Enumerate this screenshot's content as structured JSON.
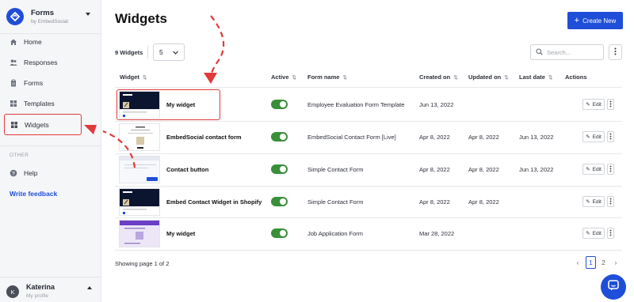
{
  "sidebar": {
    "brand_title": "Forms",
    "brand_sub": "by EmbedSocial",
    "nav": [
      {
        "label": "Home",
        "icon": "home-icon"
      },
      {
        "label": "Responses",
        "icon": "users-icon"
      },
      {
        "label": "Forms",
        "icon": "clipboard-icon"
      },
      {
        "label": "Templates",
        "icon": "grid-icon"
      },
      {
        "label": "Widgets",
        "icon": "grid-icon"
      }
    ],
    "section_other": "OTHER",
    "help": "Help",
    "feedback": "Write feedback",
    "user_name": "Katerina",
    "user_sub": "My profile",
    "user_initial": "K"
  },
  "header": {
    "title": "Widgets",
    "create_label": "Create New"
  },
  "toolbar": {
    "count_label": "9 Widgets",
    "page_size": "5",
    "search_placeholder": "Search..."
  },
  "table": {
    "columns": [
      "Widget",
      "Active",
      "Form name",
      "Created on",
      "Updated on",
      "Last date",
      "Actions"
    ],
    "edit_label": "Edit",
    "rows": [
      {
        "name": "My widget",
        "active": true,
        "form": "Employee Evaluation Form Template",
        "created": "Jun 13, 2022",
        "updated": "",
        "last": ""
      },
      {
        "name": "EmbedSocial contact form",
        "active": true,
        "form": "EmbedSocial Contact Form [Live]",
        "created": "Apr 8, 2022",
        "updated": "Apr 8, 2022",
        "last": "Jun 13, 2022"
      },
      {
        "name": "Contact button",
        "active": true,
        "form": "Simple Contact Form",
        "created": "Apr 8, 2022",
        "updated": "Apr 8, 2022",
        "last": "Jun 13, 2022"
      },
      {
        "name": "Embed Contact Widget in Shopify",
        "active": true,
        "form": "Simple Contact Form",
        "created": "Apr 8, 2022",
        "updated": "Apr 8, 2022",
        "last": ""
      },
      {
        "name": "My widget",
        "active": true,
        "form": "Job Application Form",
        "created": "Mar 28, 2022",
        "updated": "",
        "last": ""
      }
    ]
  },
  "footer": {
    "showing": "Showing page 1 of 2",
    "pages": [
      "1",
      "2"
    ],
    "current_page": "1"
  },
  "colors": {
    "accent": "#1f4ed8",
    "toggle_on": "#3a8f3a",
    "annotation": "#e03a3a"
  }
}
